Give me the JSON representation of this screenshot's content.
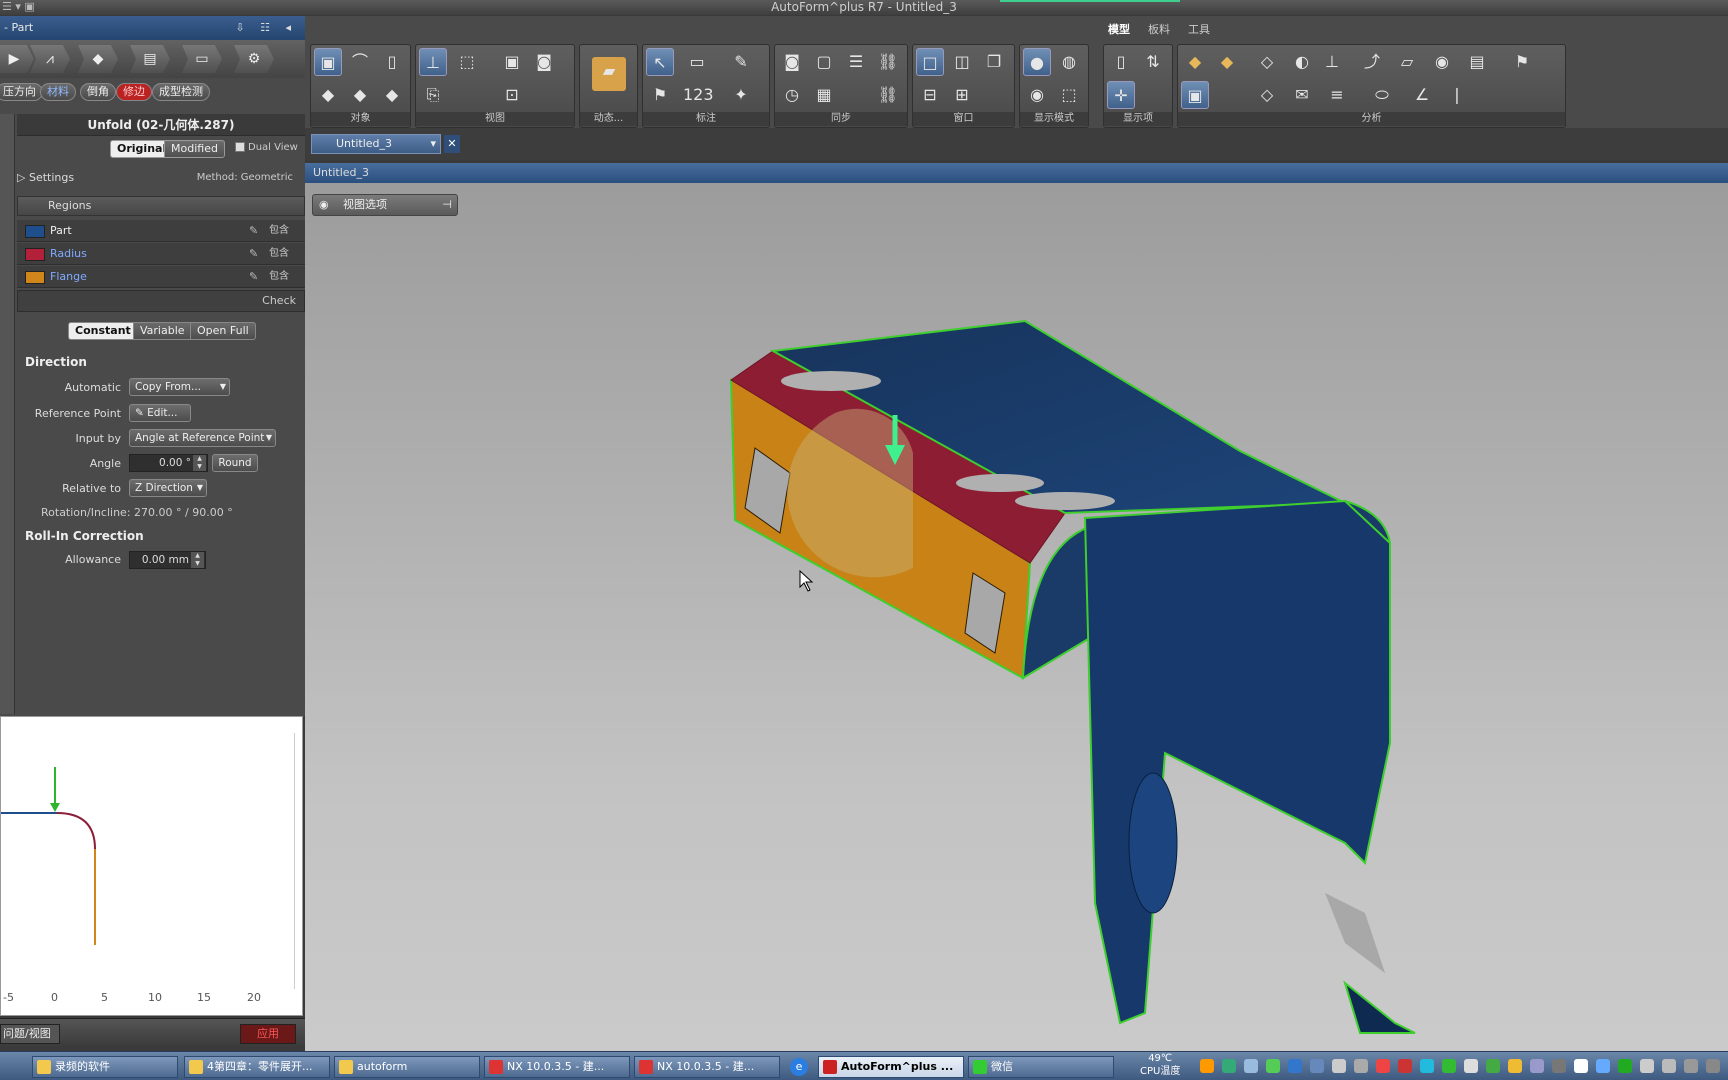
{
  "window": {
    "title": "AutoForm^plus R7 - Untitled_3"
  },
  "left_panel": {
    "header": "- Part",
    "process_tabs": [
      "压方向",
      "材料",
      "倒角",
      "修边",
      "成型检测"
    ],
    "unfold_title": "Unfold (02-几何体.287)",
    "view_toggle": {
      "original": "Original",
      "modified": "Modified",
      "dual_view": "Dual View"
    },
    "settings": {
      "label": "Settings",
      "method": "Method: Geometric"
    },
    "regions": {
      "header": "Regions",
      "items": [
        {
          "name": "Part",
          "color": "#1f4e8c",
          "status": "包含"
        },
        {
          "name": "Radius",
          "color": "#b3203a",
          "status": "包含"
        },
        {
          "name": "Flange",
          "color": "#d0861a",
          "status": "包含"
        }
      ],
      "check": "Check"
    },
    "mode": {
      "constant": "Constant",
      "variable": "Variable",
      "open_full": "Open Full"
    },
    "direction": {
      "title": "Direction",
      "automatic_label": "Automatic",
      "automatic_value": "Copy From...",
      "reference_label": "Reference Point",
      "reference_btn": "Edit...",
      "input_label": "Input by",
      "input_value": "Angle at Reference Point",
      "angle_label": "Angle",
      "angle_value": "0.00 °",
      "round_btn": "Round",
      "relative_label": "Relative to",
      "relative_value": "Z Direction",
      "rotation": "Rotation/Incline:   270.00 ° / 90.00 °"
    },
    "rollin": {
      "title": "Roll-In Correction",
      "allowance_label": "Allowance",
      "allowance_value": "0.00 mm"
    },
    "chart_ticks": [
      "-5",
      "0",
      "5",
      "10",
      "15",
      "20"
    ],
    "bottom_left": "问题/视图",
    "apply": "应用"
  },
  "ribbon": {
    "tabs": [
      "模型",
      "板料",
      "工具"
    ],
    "groups": [
      "对象",
      "视图",
      "动态...",
      "标注",
      "同步",
      "窗口",
      "显示模式",
      "显示项",
      "分析"
    ]
  },
  "document": {
    "tab": "Untitled_3",
    "view_header": "Untitled_3",
    "view_options": "视图选项"
  },
  "taskbar": {
    "items": [
      "录频的软件",
      "4第四章：零件展开...",
      "autoform",
      "NX 10.0.3.5 - 建...",
      "NX 10.0.3.5 - 建...",
      "AutoForm^plus ...",
      "微信"
    ],
    "cpu": "49℃\nCPU温度"
  }
}
